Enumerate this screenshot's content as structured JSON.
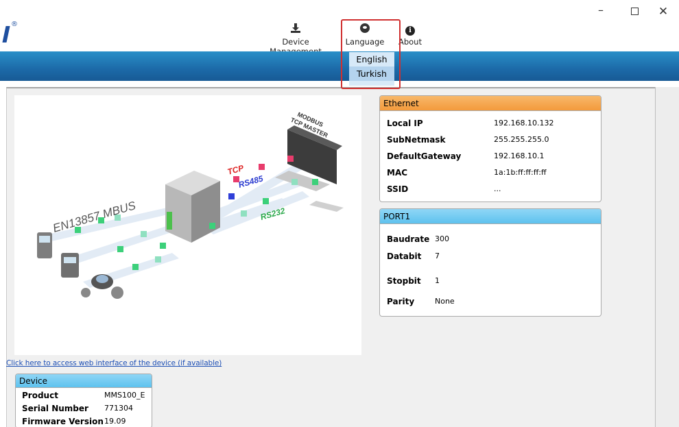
{
  "window": {
    "minimize_glyph": "–",
    "close_glyph": "✕"
  },
  "logo": {
    "reg_mark": "®"
  },
  "toolbar": {
    "device_management_label": "Device Management",
    "language_label": "Language",
    "about_label": "About"
  },
  "language_menu": {
    "options": [
      "English",
      "Turkish"
    ],
    "selected": "Turkish"
  },
  "diagram": {
    "mbus_label": "EN13857 MBUS",
    "tcp_label": "TCP",
    "rs485_label": "RS485",
    "rs232_label": "RS232",
    "modbus_label_1": "MODBUS",
    "modbus_label_2": "TCP MASTER"
  },
  "web_link": "Click here to access web interface of the device (if available)",
  "ethernet": {
    "title": "Ethernet",
    "rows": [
      {
        "key": "Local IP",
        "value": "192.168.10.132"
      },
      {
        "key": "SubNetmask",
        "value": "255.255.255.0"
      },
      {
        "key": "DefaultGateway",
        "value": "192.168.10.1"
      },
      {
        "key": "MAC",
        "value": "1a:1b:ff:ff:ff:ff"
      },
      {
        "key": "SSID",
        "value": "..."
      }
    ]
  },
  "port1": {
    "title": "PORT1",
    "rows": [
      {
        "key": "Baudrate",
        "value": "300"
      },
      {
        "key": "Databit",
        "value": "7"
      },
      {
        "key": "Stopbit",
        "value": "1"
      },
      {
        "key": "Parity",
        "value": "None"
      }
    ]
  },
  "device": {
    "title": "Device",
    "rows": [
      {
        "key": "Product",
        "value": "MMS100_E"
      },
      {
        "key": "Serial Number",
        "value": "771304"
      },
      {
        "key": "Firmware Version",
        "value": "19.09"
      }
    ]
  },
  "colors": {
    "banner": "#1c6aa8",
    "ethernet_header": "#f39a3c",
    "port_header": "#5ec2ee",
    "highlight_box": "#d03030",
    "link": "#1d4fb5"
  }
}
